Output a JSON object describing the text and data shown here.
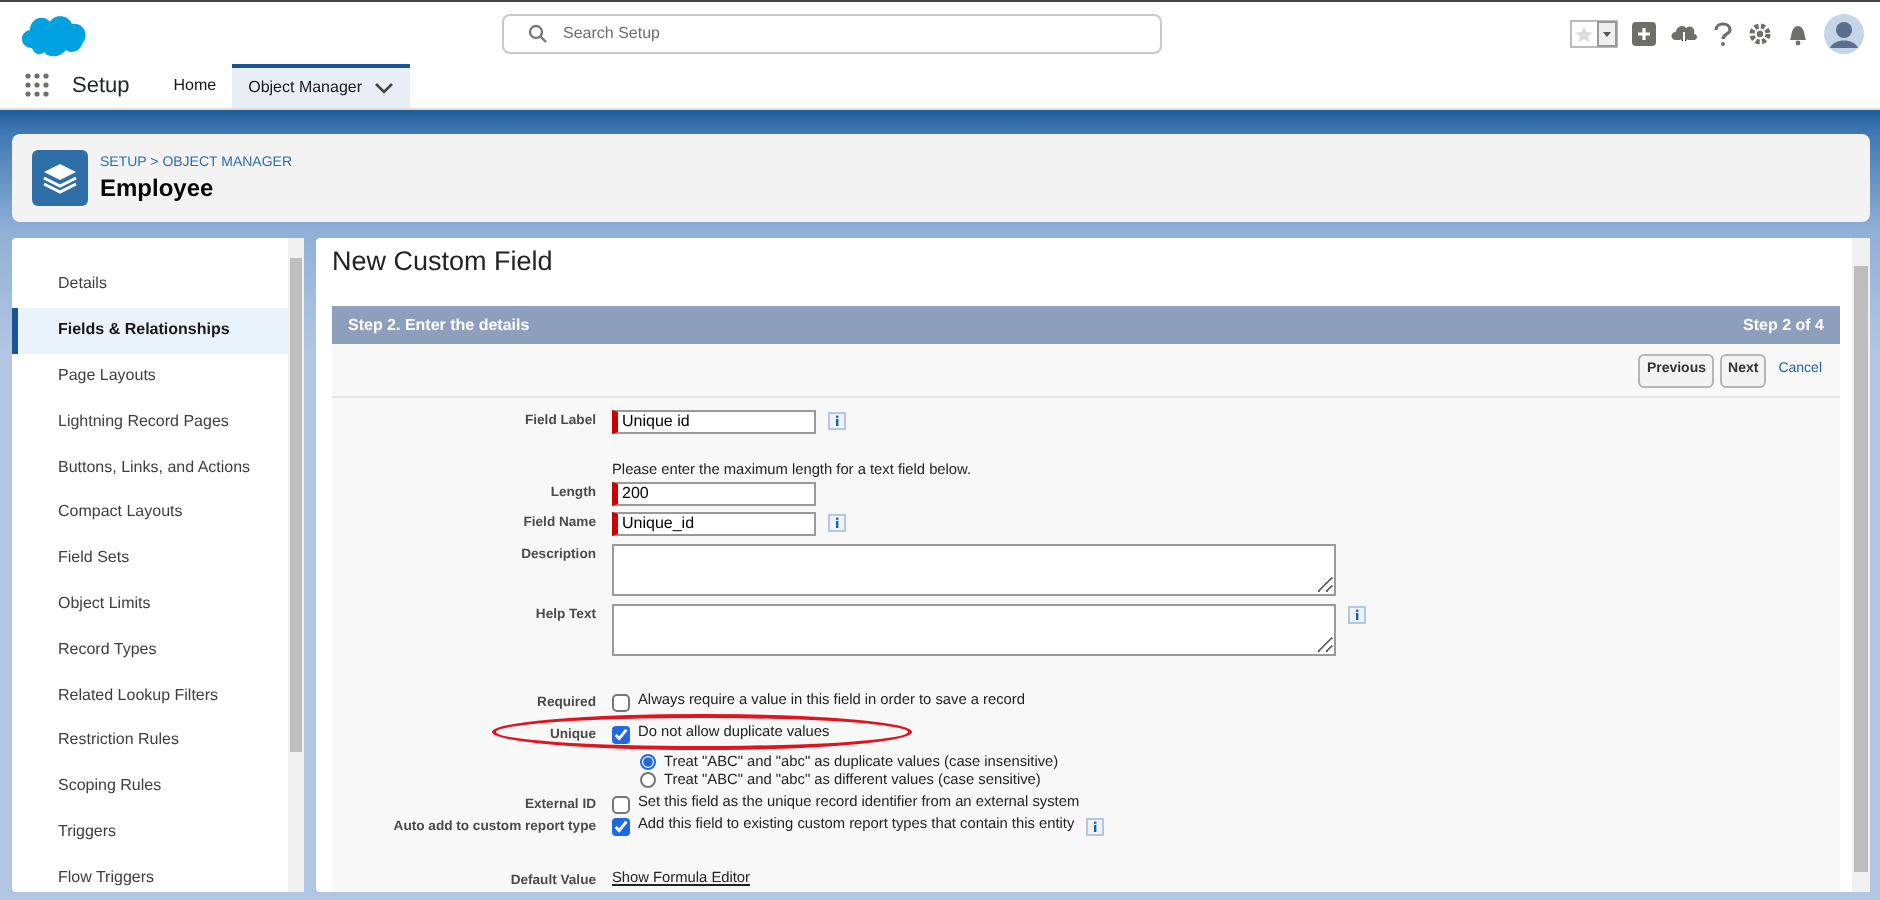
{
  "header": {
    "search": {
      "placeholder": "Search Setup"
    }
  },
  "nav": {
    "app_name": "Setup",
    "tabs": [
      {
        "label": "Home",
        "selected": false,
        "menu": false
      },
      {
        "label": "Object Manager",
        "selected": true,
        "menu": true
      }
    ]
  },
  "object_header": {
    "breadcrumb": "SETUP > OBJECT MANAGER",
    "title": "Employee"
  },
  "sidebar": {
    "items": [
      {
        "label": "Details",
        "selected": false
      },
      {
        "label": "Fields & Relationships",
        "selected": true
      },
      {
        "label": "Page Layouts",
        "selected": false
      },
      {
        "label": "Lightning Record Pages",
        "selected": false
      },
      {
        "label": "Buttons, Links, and Actions",
        "selected": false
      },
      {
        "label": "Compact Layouts",
        "selected": false
      },
      {
        "label": "Field Sets",
        "selected": false
      },
      {
        "label": "Object Limits",
        "selected": false
      },
      {
        "label": "Record Types",
        "selected": false
      },
      {
        "label": "Related Lookup Filters",
        "selected": false
      },
      {
        "label": "Restriction Rules",
        "selected": false
      },
      {
        "label": "Scoping Rules",
        "selected": false
      },
      {
        "label": "Triggers",
        "selected": false
      },
      {
        "label": "Flow Triggers",
        "selected": false
      }
    ]
  },
  "page": {
    "title": "New Custom Field",
    "step": {
      "title": "Step 2. Enter the details",
      "counter": "Step 2 of 4"
    },
    "buttons": [
      {
        "label": "Previous",
        "kind": "button"
      },
      {
        "label": "Next",
        "kind": "button"
      },
      {
        "label": "Cancel",
        "kind": "link"
      }
    ],
    "form": [
      {
        "kind": "text",
        "label": "Field Label",
        "value": "Unique id",
        "required": true,
        "info": true
      },
      {
        "kind": "note",
        "text": "Please enter the maximum length for a text field below."
      },
      {
        "kind": "text",
        "label": "Length",
        "value": "200",
        "required": true,
        "info": false
      },
      {
        "kind": "text",
        "label": "Field Name",
        "value": "Unique_id",
        "required": true,
        "info": true
      },
      {
        "kind": "textarea",
        "label": "Description",
        "info": false
      },
      {
        "kind": "textarea",
        "label": "Help Text",
        "info": true
      },
      {
        "kind": "checkbox",
        "label": "Required",
        "text": "Always require a value in this field in order to save a record",
        "checked": false,
        "info": false,
        "highlighted": false
      },
      {
        "kind": "checkbox",
        "label": "Unique",
        "text": "Do not allow duplicate values",
        "checked": true,
        "info": false,
        "highlighted": true,
        "options": [
          {
            "label": "Treat \"ABC\" and \"abc\" as duplicate values (case insensitive)",
            "selected": true
          },
          {
            "label": "Treat \"ABC\" and \"abc\" as different values (case sensitive)",
            "selected": false
          }
        ]
      },
      {
        "kind": "checkbox",
        "label": "External ID",
        "text": "Set this field as the unique record identifier from an external system",
        "checked": false,
        "info": false,
        "highlighted": false
      },
      {
        "kind": "checkbox",
        "label": "Auto add to custom report type",
        "text": "Add this field to existing custom report types that contain this entity",
        "checked": true,
        "info": true,
        "highlighted": false
      },
      {
        "kind": "link",
        "label": "Default Value",
        "text": "Show Formula Editor"
      }
    ]
  }
}
